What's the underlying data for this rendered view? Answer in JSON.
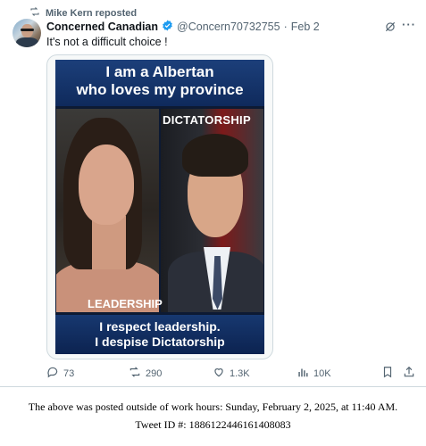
{
  "repost": {
    "label": "Mike Kern reposted"
  },
  "author": {
    "name": "Concerned Canadian",
    "handle": "@Concern70732755",
    "separator": "·",
    "date": "Feb 2"
  },
  "tweet": {
    "text": "It's not a difficult choice !"
  },
  "media": {
    "top_banner": [
      "I am a Albertan",
      "who loves my province"
    ],
    "right_label": "DICTATORSHIP",
    "left_label": "LEADERSHIP",
    "bottom_banner": [
      "I respect leadership.",
      "I despise Dictatorship"
    ]
  },
  "actions": {
    "replies": "73",
    "reposts": "290",
    "likes": "1.3K",
    "views": "10K"
  },
  "icons": [
    "repost-icon",
    "verified-badge-icon",
    "grok-icon",
    "more-icon",
    "reply-icon",
    "like-icon",
    "views-icon",
    "bookmark-icon",
    "share-icon"
  ],
  "colors": {
    "verified": "#1d9bf0",
    "muted": "#536471",
    "banner": "#173870"
  },
  "footer": {
    "line1": "The above was posted outside of work hours: Sunday, February 2, 2025, at 11:40 AM.",
    "line2": "Tweet ID #: 1886122446161408083"
  }
}
